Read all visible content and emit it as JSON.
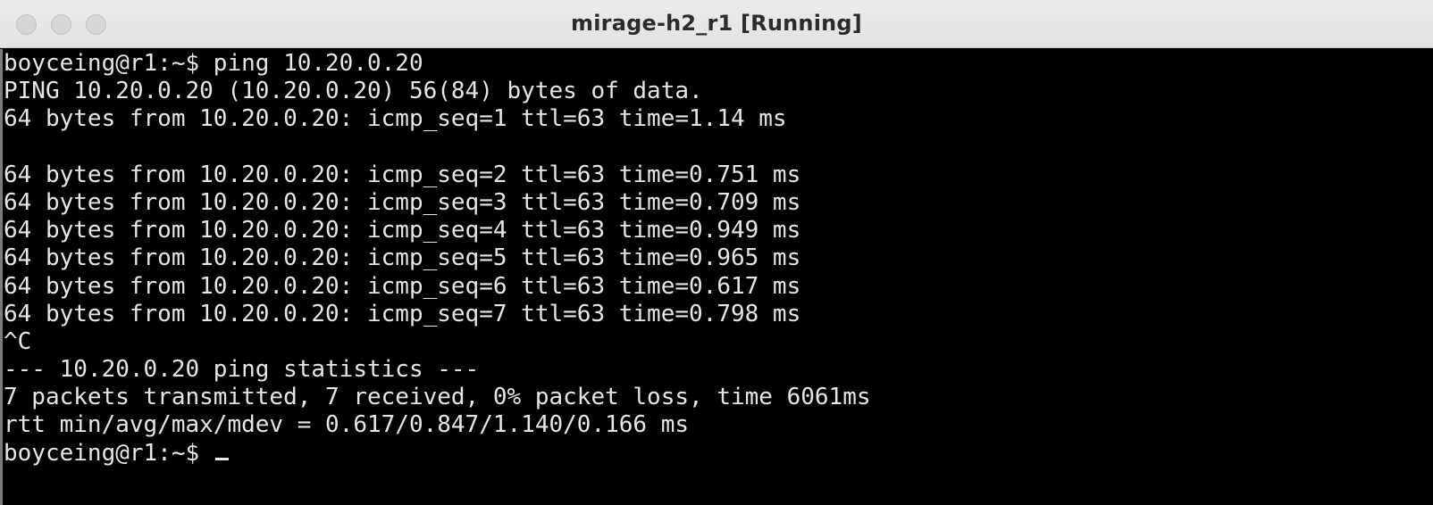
{
  "window": {
    "title": "mirage-h2_r1 [Running]"
  },
  "terminal": {
    "lines": [
      "boyceing@r1:~$ ping 10.20.0.20",
      "PING 10.20.0.20 (10.20.0.20) 56(84) bytes of data.",
      "64 bytes from 10.20.0.20: icmp_seq=1 ttl=63 time=1.14 ms",
      "",
      "64 bytes from 10.20.0.20: icmp_seq=2 ttl=63 time=0.751 ms",
      "64 bytes from 10.20.0.20: icmp_seq=3 ttl=63 time=0.709 ms",
      "64 bytes from 10.20.0.20: icmp_seq=4 ttl=63 time=0.949 ms",
      "64 bytes from 10.20.0.20: icmp_seq=5 ttl=63 time=0.965 ms",
      "64 bytes from 10.20.0.20: icmp_seq=6 ttl=63 time=0.617 ms",
      "64 bytes from 10.20.0.20: icmp_seq=7 ttl=63 time=0.798 ms",
      "^C",
      "--- 10.20.0.20 ping statistics ---",
      "7 packets transmitted, 7 received, 0% packet loss, time 6061ms",
      "rtt min/avg/max/mdev = 0.617/0.847/1.140/0.166 ms"
    ],
    "prompt": "boyceing@r1:~$ "
  },
  "colors": {
    "background": "#000000",
    "foreground": "#e6e6e6",
    "titlebar": "#e6e6e6"
  }
}
